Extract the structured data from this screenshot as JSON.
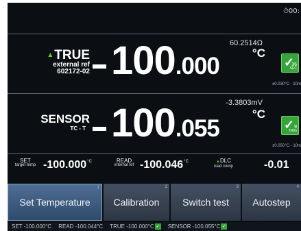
{
  "status_top": {
    "timer_icon": "clock-icon",
    "timer_text": "00:"
  },
  "true_panel": {
    "label": "TRUE",
    "sub1": "external ref",
    "sub2": "602172-02",
    "value_int": "100",
    "value_dec": ".000",
    "raw": "60.2514Ω",
    "unit": "°C",
    "check": {
      "count": "36",
      "units": "SEC",
      "status_color": "#37a33c"
    },
    "tolerance": "±0.030°C - 10m"
  },
  "sensor_panel": {
    "label": "SENSOR",
    "sub": "TC - T",
    "value_int": "100",
    "value_dec": ".055",
    "raw": "-3.3803mV",
    "unit": "°C",
    "check": {
      "count": "9",
      "units": "TRIG",
      "status_color": "#37a33c"
    },
    "tolerance": "±0.050°C - 10m"
  },
  "info": {
    "set_label": "SET",
    "set_sub": "target temp",
    "set_value": "-100.000",
    "set_unit": "°C",
    "read_label": "READ",
    "read_sub": "internal ref",
    "read_value": "-100.046",
    "read_unit": "°C",
    "dlc_label": "DLC",
    "dlc_sub": "load comp",
    "dlc_value": "-0.01"
  },
  "buttons": [
    {
      "label": "Set Temperature",
      "num": "1"
    },
    {
      "label": "Calibration",
      "num": "2"
    },
    {
      "label": "Switch test",
      "num": "3"
    },
    {
      "label": "Autostep",
      "num": "4"
    }
  ],
  "status_bar": {
    "set": "SET -100.000°C",
    "read": "READ -100.044°C",
    "true": "TRUE -100.000°C",
    "sensor": "SENSOR -100.055°C"
  },
  "colors": {
    "accent_green": "#37a33c",
    "background": "#0b0e12",
    "button_active": "#4f6e93"
  }
}
